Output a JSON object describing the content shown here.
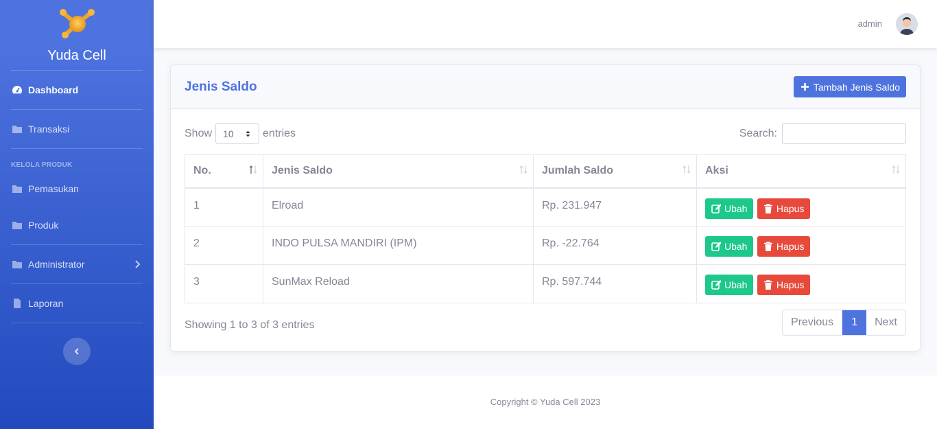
{
  "sidebar": {
    "brand": "Yuda Cell",
    "items": [
      {
        "label": "Dashboard",
        "icon": "tachometer-icon"
      },
      {
        "label": "Transaksi",
        "icon": "folder-icon"
      },
      {
        "label": "Pemasukan",
        "icon": "folder-icon"
      },
      {
        "label": "Produk",
        "icon": "folder-icon"
      },
      {
        "label": "Administrator",
        "icon": "folder-icon"
      },
      {
        "label": "Laporan",
        "icon": "file-icon"
      }
    ],
    "heading": "KELOLA PRODUK"
  },
  "topbar": {
    "user": "admin"
  },
  "card": {
    "title": "Jenis Saldo",
    "add_label": "Tambah Jenis Saldo",
    "show_label": "Show",
    "entries_value": "10",
    "entries_label": "entries",
    "search_label": "Search:",
    "columns": [
      "No.",
      "Jenis Saldo",
      "Jumlah Saldo",
      "Aksi"
    ],
    "rows": [
      {
        "no": "1",
        "jenis": "Elroad",
        "jumlah": "Rp. 231.947"
      },
      {
        "no": "2",
        "jenis": "INDO PULSA MANDIRI (IPM)",
        "jumlah": "Rp. -22.764"
      },
      {
        "no": "3",
        "jenis": "SunMax Reload",
        "jumlah": "Rp. 597.744"
      }
    ],
    "edit_label": "Ubah",
    "delete_label": "Hapus",
    "info": "Showing 1 to 3 of 3 entries",
    "pagination": {
      "previous": "Previous",
      "page": "1",
      "next": "Next"
    }
  },
  "footer": {
    "copyright": "Copyright © Yuda Cell 2023"
  },
  "colors": {
    "primary": "#4e73df",
    "success": "#1cc88a",
    "danger": "#e74a3b"
  }
}
